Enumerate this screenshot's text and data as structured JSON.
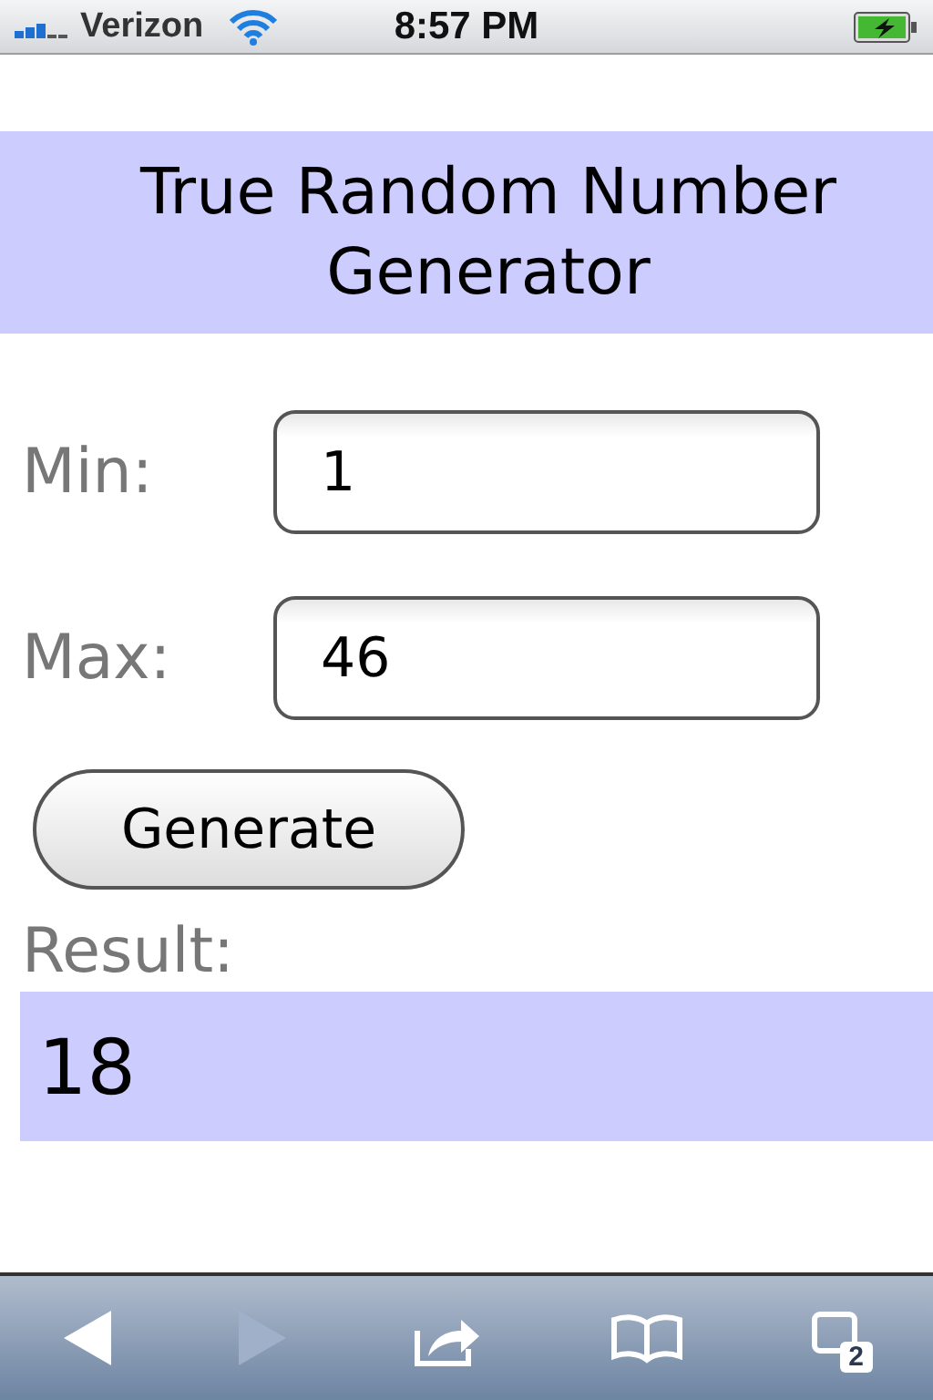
{
  "status_bar": {
    "carrier": "Verizon",
    "time": "8:57 PM",
    "battery_charging": true
  },
  "title": "True Random Number Generator",
  "fields": [
    {
      "label": "Min:",
      "value": "1"
    },
    {
      "label": "Max:",
      "value": "46"
    }
  ],
  "generate_button": "Generate",
  "result": {
    "label": "Result:",
    "value": "18"
  },
  "toolbar": {
    "back_disabled": false,
    "forward_disabled": true,
    "tab_count": "2"
  }
}
